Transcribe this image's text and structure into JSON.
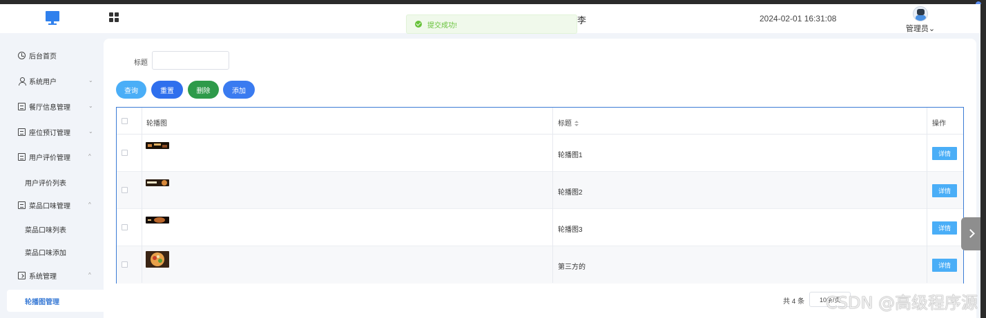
{
  "header": {
    "title_fragment": "李",
    "datetime": "2024-02-01 16:31:08",
    "username": "管理员",
    "username_chevron": "⌄"
  },
  "toast": {
    "message": "提交成功!"
  },
  "sidebar": {
    "items": [
      {
        "label": "后台首页",
        "icon": "clock-icon",
        "chevron": ""
      },
      {
        "label": "系统用户",
        "icon": "user-icon",
        "chevron": "⌄"
      },
      {
        "label": "餐厅信息管理",
        "icon": "card-icon",
        "chevron": "⌄"
      },
      {
        "label": "座位预订管理",
        "icon": "card-icon",
        "chevron": "⌄"
      },
      {
        "label": "用户评价管理",
        "icon": "card-icon",
        "chevron": "^"
      },
      {
        "label": "用户评价列表",
        "sub": true
      },
      {
        "label": "菜品口味管理",
        "icon": "card-icon",
        "chevron": "^"
      },
      {
        "label": "菜品口味列表",
        "sub": true
      },
      {
        "label": "菜品口味添加",
        "sub": true
      },
      {
        "label": "系统管理",
        "icon": "folder-icon",
        "chevron": "^"
      },
      {
        "label": "轮播图管理",
        "sub": true,
        "active": true
      }
    ]
  },
  "search": {
    "label": "标题",
    "value": ""
  },
  "toolbar": {
    "query": "查询",
    "reset": "重置",
    "delete": "删除",
    "add": "添加"
  },
  "table": {
    "headers": {
      "image": "轮播图",
      "title": "标题",
      "actions": "操作"
    },
    "rows": [
      {
        "title": "轮播图1",
        "action": "详情"
      },
      {
        "title": "轮播图2",
        "action": "详情"
      },
      {
        "title": "轮播图3",
        "action": "详情"
      },
      {
        "title": "第三方的",
        "action": "详情"
      }
    ]
  },
  "pagination": {
    "total": "共 4 条",
    "page_size": "10条/页"
  },
  "watermark": "CSDN @高级程序源",
  "colors": {
    "primary": "#3a7bd5",
    "success": "#67c23a",
    "info_button": "#4aaef7",
    "delete_button": "#2e9a4a"
  }
}
